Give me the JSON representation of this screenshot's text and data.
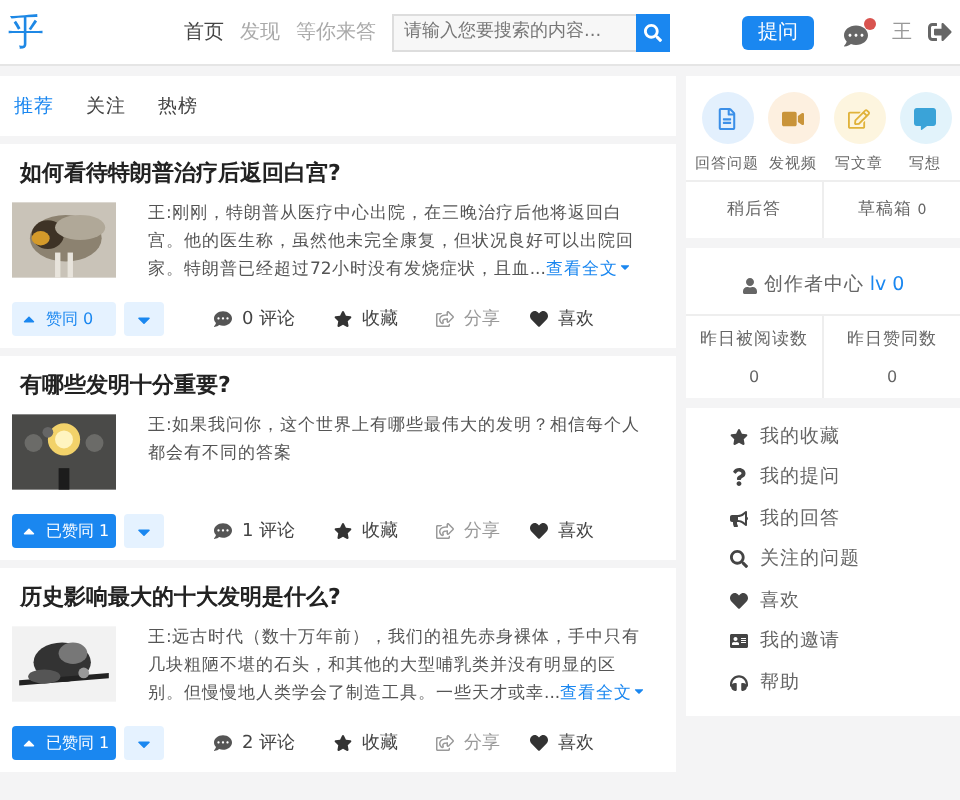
{
  "header": {
    "logo": "乎",
    "nav": [
      {
        "label": "首页",
        "selected": true
      },
      {
        "label": "发现",
        "selected": false
      },
      {
        "label": "等你来答",
        "selected": false
      }
    ],
    "search": {
      "placeholder": "请输入您要搜索的内容..."
    },
    "ask_button": "提问",
    "user": "王"
  },
  "feed_tabs": [
    {
      "label": "推荐",
      "selected": true
    },
    {
      "label": "关注",
      "selected": false
    },
    {
      "label": "热榜",
      "selected": false
    }
  ],
  "articles": [
    {
      "title": "如何看待特朗普治疗后返回白宫?",
      "excerpt": "王:刚刚，特朗普从医疗中心出院，在三晚治疗后他将返回白宫。他的医生称，虽然他未完全康复，但状况良好可以出院回家。特朗普已经超过72小时没有发烧症状，且血...",
      "more": "查看全文",
      "vote": {
        "label": "赞同 0",
        "voted": false
      },
      "comments": "0 评论",
      "favorite": "收藏",
      "share": "分享",
      "like": "喜欢"
    },
    {
      "title": "有哪些发明十分重要?",
      "excerpt": "王:如果我问你，这个世界上有哪些最伟大的发明？相信每个人都会有不同的答案",
      "vote": {
        "label": "已赞同 1",
        "voted": true
      },
      "comments": "1 评论",
      "favorite": "收藏",
      "share": "分享",
      "like": "喜欢"
    },
    {
      "title": "历史影响最大的十大发明是什么?",
      "excerpt": "王:远古时代（数十万年前），我们的祖先赤身裸体，手中只有几块粗陋不堪的石头，和其他的大型哺乳类并没有明显的区别。但慢慢地人类学会了制造工具。一些天才或幸...",
      "more": "查看全文",
      "vote": {
        "label": "已赞同 1",
        "voted": true
      },
      "comments": "2 评论",
      "favorite": "收藏",
      "share": "分享",
      "like": "喜欢"
    }
  ],
  "quick_actions": [
    {
      "label": "回答问题",
      "kind": "answer"
    },
    {
      "label": "发视频",
      "kind": "video"
    },
    {
      "label": "写文章",
      "kind": "article"
    },
    {
      "label": "写想",
      "kind": "idea"
    }
  ],
  "drafts": [
    {
      "label": "稍后答"
    },
    {
      "label": "草稿箱",
      "count": "0"
    }
  ],
  "creator": {
    "title": "创作者中心",
    "level": "lv 0",
    "stats": [
      {
        "label": "昨日被阅读数",
        "value": "0"
      },
      {
        "label": "昨日赞同数",
        "value": "0"
      }
    ]
  },
  "menu": [
    {
      "label": "我的收藏",
      "kind": "star"
    },
    {
      "label": "我的提问",
      "kind": "question"
    },
    {
      "label": "我的回答",
      "kind": "bullhorn"
    },
    {
      "label": "关注的问题",
      "kind": "search"
    },
    {
      "label": "喜欢",
      "kind": "heart"
    },
    {
      "label": "我的邀请",
      "kind": "invite"
    },
    {
      "label": "帮助",
      "kind": "help"
    }
  ]
}
